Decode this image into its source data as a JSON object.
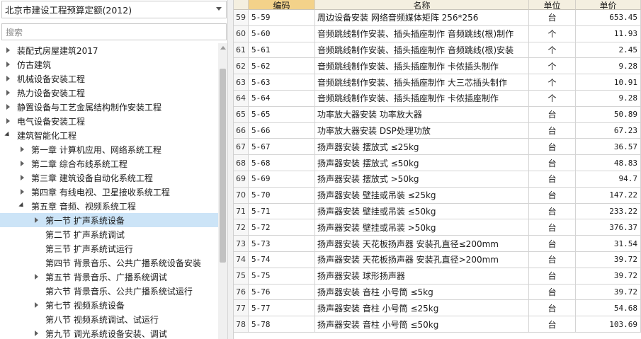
{
  "quota_select": {
    "value": "北京市建设工程预算定额(2012)"
  },
  "search": {
    "placeholder": "搜索"
  },
  "tree": [
    {
      "label": "装配式房屋建筑2017",
      "level": 0,
      "state": "collapsed",
      "selected": false
    },
    {
      "label": "仿古建筑",
      "level": 0,
      "state": "collapsed",
      "selected": false
    },
    {
      "label": "机械设备安装工程",
      "level": 0,
      "state": "collapsed",
      "selected": false
    },
    {
      "label": "热力设备安装工程",
      "level": 0,
      "state": "collapsed",
      "selected": false
    },
    {
      "label": "静置设备与工艺金属结构制作安装工程",
      "level": 0,
      "state": "collapsed",
      "selected": false
    },
    {
      "label": "电气设备安装工程",
      "level": 0,
      "state": "collapsed",
      "selected": false
    },
    {
      "label": "建筑智能化工程",
      "level": 0,
      "state": "expanded",
      "selected": false
    },
    {
      "label": "第一章 计算机应用、网络系统工程",
      "level": 1,
      "state": "collapsed",
      "selected": false
    },
    {
      "label": "第二章 综合布线系统工程",
      "level": 1,
      "state": "collapsed",
      "selected": false
    },
    {
      "label": "第三章 建筑设备自动化系统工程",
      "level": 1,
      "state": "collapsed",
      "selected": false
    },
    {
      "label": "第四章 有线电视、卫星接收系统工程",
      "level": 1,
      "state": "collapsed",
      "selected": false
    },
    {
      "label": "第五章 音频、视频系统工程",
      "level": 1,
      "state": "expanded",
      "selected": false
    },
    {
      "label": "第一节 扩声系统设备",
      "level": 2,
      "state": "collapsed",
      "selected": true
    },
    {
      "label": "第二节 扩声系统调试",
      "level": 2,
      "state": "none",
      "selected": false
    },
    {
      "label": "第三节 扩声系统试运行",
      "level": 2,
      "state": "none",
      "selected": false
    },
    {
      "label": "第四节 背景音乐、公共广播系统设备安装",
      "level": 2,
      "state": "none",
      "selected": false
    },
    {
      "label": "第五节 背景音乐、广播系统调试",
      "level": 2,
      "state": "collapsed",
      "selected": false
    },
    {
      "label": "第六节 背景音乐、公共广播系统试运行",
      "level": 2,
      "state": "none",
      "selected": false
    },
    {
      "label": "第七节 视频系统设备",
      "level": 2,
      "state": "collapsed",
      "selected": false
    },
    {
      "label": "第八节 视频系统调试、试运行",
      "level": 2,
      "state": "none",
      "selected": false
    },
    {
      "label": "第九节 调光系统设备安装、调试",
      "level": 2,
      "state": "collapsed",
      "selected": false
    }
  ],
  "grid": {
    "headers": {
      "code": "编码",
      "name": "名称",
      "unit": "单位",
      "price": "单价"
    },
    "rows": [
      {
        "idx": "59",
        "code": "5-59",
        "name": "周边设备安装 网络音频媒体矩阵 256*256",
        "unit": "台",
        "price": "653.45"
      },
      {
        "idx": "60",
        "code": "5-60",
        "name": "音频跳线制作安装、插头插座制作 音频跳线(根)制作",
        "unit": "个",
        "price": "11.93"
      },
      {
        "idx": "61",
        "code": "5-61",
        "name": "音频跳线制作安装、插头插座制作 音频跳线(根)安装",
        "unit": "个",
        "price": "2.45"
      },
      {
        "idx": "62",
        "code": "5-62",
        "name": "音频跳线制作安装、插头插座制作 卡侬插头制作",
        "unit": "个",
        "price": "9.28"
      },
      {
        "idx": "63",
        "code": "5-63",
        "name": "音频跳线制作安装、插头插座制作 大三芯插头制作",
        "unit": "个",
        "price": "10.91"
      },
      {
        "idx": "64",
        "code": "5-64",
        "name": "音频跳线制作安装、插头插座制作 卡侬插座制作",
        "unit": "个",
        "price": "9.28"
      },
      {
        "idx": "65",
        "code": "5-65",
        "name": "功率放大器安装 功率放大器",
        "unit": "台",
        "price": "50.89"
      },
      {
        "idx": "66",
        "code": "5-66",
        "name": "功率放大器安装 DSP处理功放",
        "unit": "台",
        "price": "67.23"
      },
      {
        "idx": "67",
        "code": "5-67",
        "name": "扬声器安装 摆放式 ≤25kg",
        "unit": "台",
        "price": "36.57"
      },
      {
        "idx": "68",
        "code": "5-68",
        "name": "扬声器安装 摆放式 ≤50kg",
        "unit": "台",
        "price": "48.83"
      },
      {
        "idx": "69",
        "code": "5-69",
        "name": "扬声器安装 摆放式 >50kg",
        "unit": "台",
        "price": "94.7"
      },
      {
        "idx": "70",
        "code": "5-70",
        "name": "扬声器安装 壁挂或吊装 ≤25kg",
        "unit": "台",
        "price": "147.22"
      },
      {
        "idx": "71",
        "code": "5-71",
        "name": "扬声器安装 壁挂或吊装 ≤50kg",
        "unit": "台",
        "price": "233.22"
      },
      {
        "idx": "72",
        "code": "5-72",
        "name": "扬声器安装 壁挂或吊装 >50kg",
        "unit": "台",
        "price": "376.37"
      },
      {
        "idx": "73",
        "code": "5-73",
        "name": "扬声器安装 天花板扬声器 安装孔直径≤200mm",
        "unit": "台",
        "price": "31.54"
      },
      {
        "idx": "74",
        "code": "5-74",
        "name": "扬声器安装 天花板扬声器 安装孔直径>200mm",
        "unit": "台",
        "price": "39.72"
      },
      {
        "idx": "75",
        "code": "5-75",
        "name": "扬声器安装 球形扬声器",
        "unit": "台",
        "price": "39.72"
      },
      {
        "idx": "76",
        "code": "5-76",
        "name": "扬声器安装 音柱 小号筒 ≤5kg",
        "unit": "台",
        "price": "39.72"
      },
      {
        "idx": "77",
        "code": "5-77",
        "name": "扬声器安装 音柱 小号筒 ≤25kg",
        "unit": "台",
        "price": "54.68"
      },
      {
        "idx": "78",
        "code": "5-78",
        "name": "扬声器安装 音柱 小号筒 ≤50kg",
        "unit": "台",
        "price": "103.69"
      }
    ]
  }
}
